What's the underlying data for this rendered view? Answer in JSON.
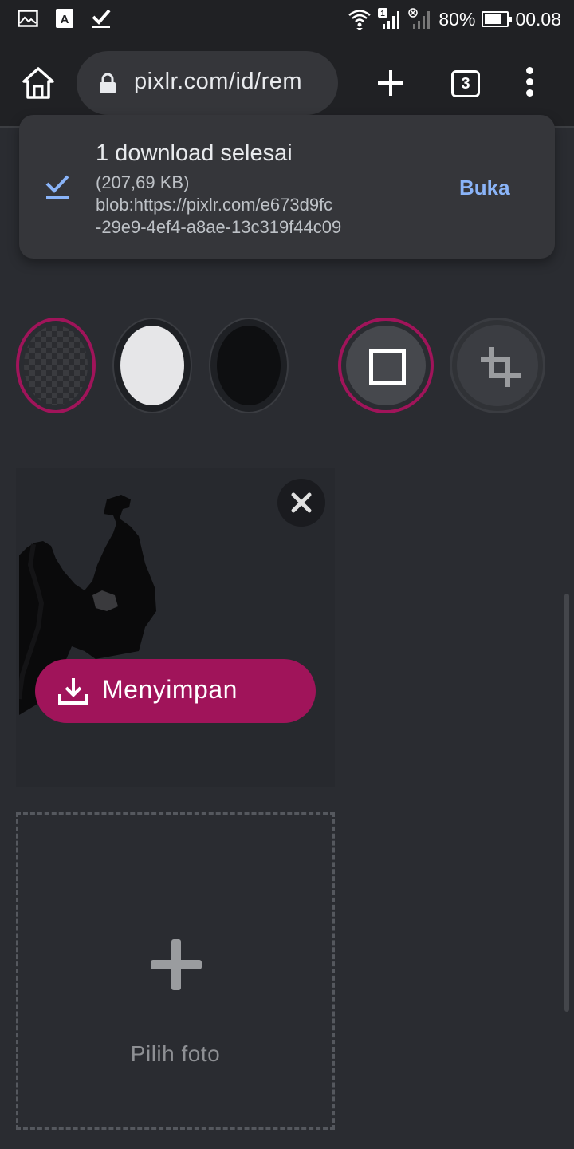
{
  "status_bar": {
    "icons": [
      "image-icon",
      "font-icon",
      "check-icon",
      "wifi-icon",
      "signal-icon",
      "no-signal-icon"
    ],
    "sim_badge": "1",
    "battery": "80%",
    "battery_level": 0.8,
    "time": "00.08"
  },
  "browser": {
    "url": "pixlr.com/id/rem",
    "tab_count": "3"
  },
  "download_notice": {
    "title": "1 download selesai",
    "size": "(207,69 KB)",
    "url_line1": "blob:https://pixlr.com/e673d9fc",
    "url_line2": "-29e9-4ef4-a8ae-13c319f44c09",
    "open_label": "Buka"
  },
  "options": {
    "selected_background": "transparent",
    "selected_frame": "square"
  },
  "result": {
    "save_label": "Menyimpan"
  },
  "picker": {
    "label": "Pilih foto"
  },
  "colors": {
    "accent": "#a0145a",
    "link": "#8ab4f8",
    "background": "#2a2c31"
  }
}
